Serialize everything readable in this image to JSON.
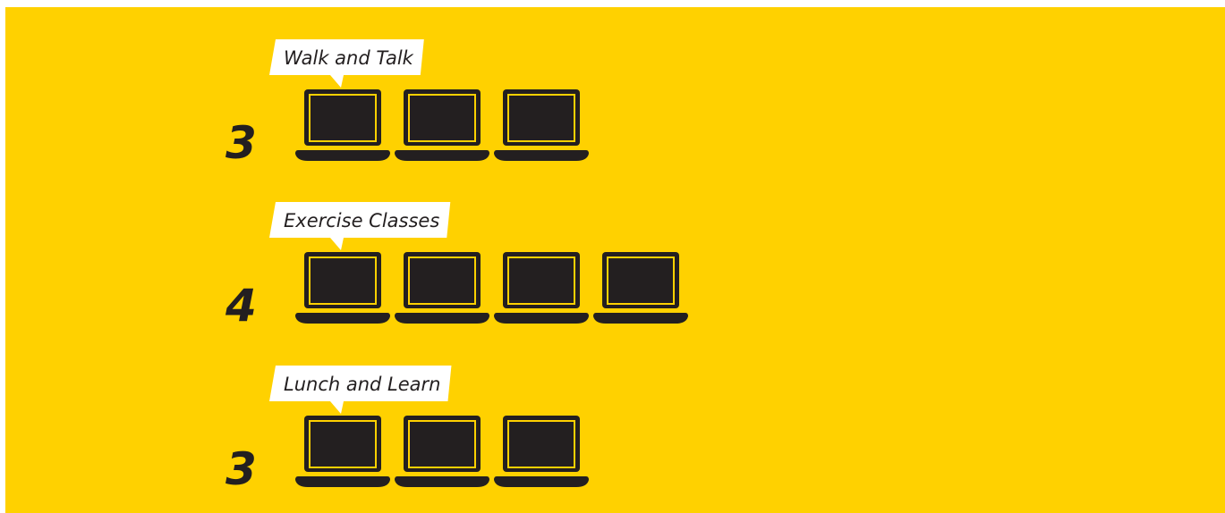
{
  "colors": {
    "background": "#FFD100",
    "icon": "#231F20",
    "label_box": "#FFFFFF",
    "text": "#231F20"
  },
  "icon_name": "laptop-icon",
  "chart_data": {
    "type": "pictograph",
    "categories": [
      "Walk and Talk",
      "Exercise Classes",
      "Lunch and Learn"
    ],
    "values": [
      3,
      4,
      3
    ],
    "unit_icon": "laptop"
  }
}
